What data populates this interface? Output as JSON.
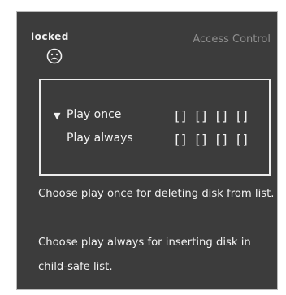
{
  "header": {
    "status": "locked",
    "title": "Access Control",
    "status_icon": "sad-face-icon"
  },
  "panel": {
    "rows": [
      {
        "label": "Play once",
        "selected": true,
        "slots": [
          "[]",
          "[]",
          "[]",
          "[]"
        ]
      },
      {
        "label": "Play always",
        "selected": false,
        "slots": [
          "[]",
          "[]",
          "[]",
          "[]"
        ]
      }
    ],
    "selected_marker": "▼"
  },
  "info": {
    "line1": "Choose play once for deleting disk from list.",
    "line2": "Choose play always for inserting disk in",
    "line3": "child-safe list."
  },
  "colors": {
    "background": "#3c3c3c",
    "title": "#8e8e8e",
    "text": "#f2f2f2"
  }
}
